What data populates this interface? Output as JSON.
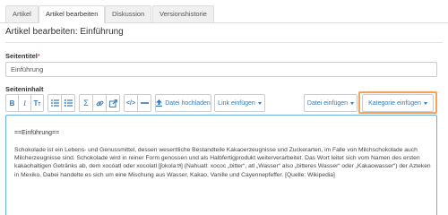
{
  "tabs": [
    {
      "label": "Artikel"
    },
    {
      "label": "Artikel bearbeiten"
    },
    {
      "label": "Diskussion"
    },
    {
      "label": "Versionshistorie"
    }
  ],
  "page_title": "Artikel bearbeiten: Einführung",
  "form": {
    "title_label": "Seitentitel",
    "required_mark": "*",
    "title_value": "Einführung",
    "content_label": "Seiteninhalt"
  },
  "toolbar": {
    "upload_label": "Datei hochladen",
    "insert_link_label": "Link einfügen",
    "insert_file_label": "Datei einfügen",
    "insert_category_label": "Kategorie einfügen"
  },
  "editor": {
    "heading": "==Einführung==",
    "body": "Schokolade ist ein Lebens- und Genussmittel, dessen wesentliche Bestandteile Kakaoerzeugnisse und Zuckerarten, im Falle von Milchschokolade auch Milcherzeugnisse sind. Schokolade wird in reiner Form genossen und als Halbfertigprodukt weiterverarbeitet. Das Wort leitet sich vom Namen des ersten kakaohaltigen Getränks ab, dem xocóatl oder xocolatl [ʃokola:tɬ] (Nahuatl: xococ „bitter“, atl „Wasser“ also „bitteres Wasser“ oder „Kakaowasser“) der Azteken in Mexiko. Dabei handelte es sich um eine Mischung aus Wasser, Kakao, Vanille und Cayennepfeffer. [Quelle: Wikipedia]"
  }
}
